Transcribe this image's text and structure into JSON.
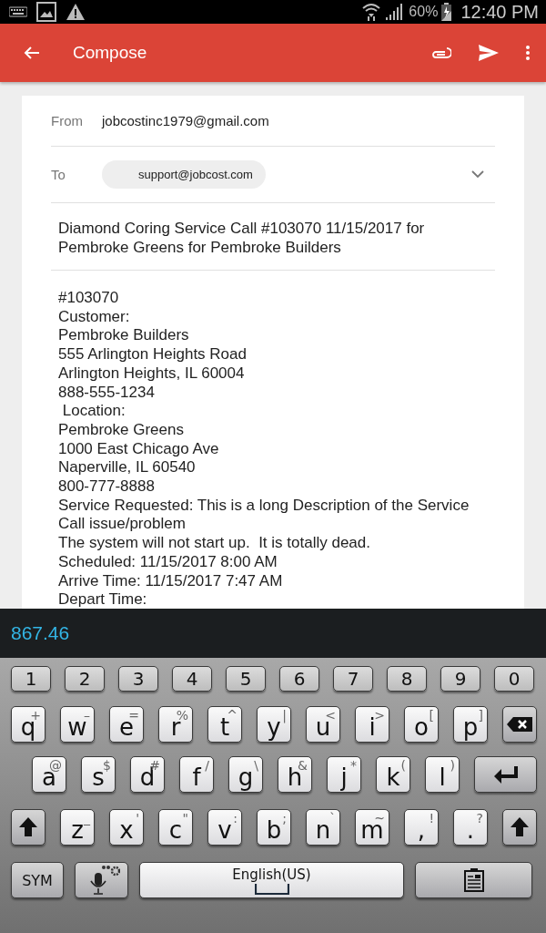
{
  "status_bar": {
    "battery": "60%",
    "time": "12:40 PM"
  },
  "app_bar": {
    "title": "Compose"
  },
  "from": {
    "label": "From",
    "value": "jobcostinc1979@gmail.com"
  },
  "to": {
    "label": "To",
    "recipients": [
      "support@jobcost.com"
    ],
    "expanded": false
  },
  "subject": "Diamond Coring Service Call #103070 11/15/2017 for Pembroke Greens for Pembroke Builders",
  "body": [
    "#103070",
    "Customer:",
    "Pembroke Builders",
    "555 Arlington Heights Road",
    "Arlington Heights, IL 60004",
    "888-555-1234",
    " Location:",
    "Pembroke Greens",
    "1000 East Chicago Ave",
    "Naperville, IL 60540",
    "800-777-8888",
    "Service Requested: This is a long Description of the Service Call issue/problem",
    "The system will not start up.  It is totally dead.",
    "Scheduled: 11/15/2017 8:00 AM",
    "Arrive Time: 11/15/2017 7:47 AM",
    "Depart Time:"
  ],
  "suggestion": "867.46",
  "keyboard": {
    "number_row": {
      "keys": [
        {
          "kind": "num",
          "label": "1"
        },
        {
          "kind": "num",
          "label": "2"
        },
        {
          "kind": "num",
          "label": "3"
        },
        {
          "kind": "num",
          "label": "4"
        },
        {
          "kind": "num",
          "label": "5"
        },
        {
          "kind": "num",
          "label": "6"
        },
        {
          "kind": "num",
          "label": "7"
        },
        {
          "kind": "num",
          "label": "8"
        },
        {
          "kind": "num",
          "label": "9"
        },
        {
          "kind": "num",
          "label": "0"
        }
      ]
    },
    "top_letter_row": {
      "keys": [
        {
          "kind": "char",
          "label": "q",
          "alt": "+"
        },
        {
          "kind": "char",
          "label": "w",
          "alt": "–"
        },
        {
          "kind": "char",
          "label": "e",
          "alt": "="
        },
        {
          "kind": "char",
          "label": "r",
          "alt": "%"
        },
        {
          "kind": "char",
          "label": "t",
          "alt": "^"
        },
        {
          "kind": "char",
          "label": "y",
          "alt": "|"
        },
        {
          "kind": "char",
          "label": "u",
          "alt": "<"
        },
        {
          "kind": "char",
          "label": "i",
          "alt": ">"
        },
        {
          "kind": "char",
          "label": "o",
          "alt": "["
        },
        {
          "kind": "char",
          "label": "p",
          "alt": "]"
        },
        {
          "kind": "backspace"
        }
      ]
    },
    "home_letter_row": {
      "keys": [
        {
          "kind": "char",
          "label": "a",
          "alt": "@"
        },
        {
          "kind": "char",
          "label": "s",
          "alt": "$"
        },
        {
          "kind": "char",
          "label": "d",
          "alt": "#"
        },
        {
          "kind": "char",
          "label": "f",
          "alt": "/"
        },
        {
          "kind": "char",
          "label": "g",
          "alt": "\\"
        },
        {
          "kind": "char",
          "label": "h",
          "alt": "&"
        },
        {
          "kind": "char",
          "label": "j",
          "alt": "*"
        },
        {
          "kind": "char",
          "label": "k",
          "alt": "("
        },
        {
          "kind": "char",
          "label": "l",
          "alt": ")"
        },
        {
          "kind": "enter"
        }
      ]
    },
    "bottom_letter_row": {
      "keys": [
        {
          "kind": "shift"
        },
        {
          "kind": "char",
          "label": "z",
          "alt": "_"
        },
        {
          "kind": "char",
          "label": "x",
          "alt": "'"
        },
        {
          "kind": "char",
          "label": "c",
          "alt": "\""
        },
        {
          "kind": "char",
          "label": "v",
          "alt": ":"
        },
        {
          "kind": "char",
          "label": "b",
          "alt": ";"
        },
        {
          "kind": "char",
          "label": "n",
          "alt": "`"
        },
        {
          "kind": "char",
          "label": "m",
          "alt": "~"
        },
        {
          "kind": "char",
          "label": ",",
          "alt": "!"
        },
        {
          "kind": "char",
          "label": ".",
          "alt": "?"
        },
        {
          "kind": "shift"
        }
      ]
    },
    "function_row": {
      "keys": [
        {
          "kind": "sym",
          "label": "SYM"
        },
        {
          "kind": "mic"
        },
        {
          "kind": "space",
          "label": "English(US)"
        },
        {
          "kind": "clipboard"
        }
      ]
    }
  }
}
